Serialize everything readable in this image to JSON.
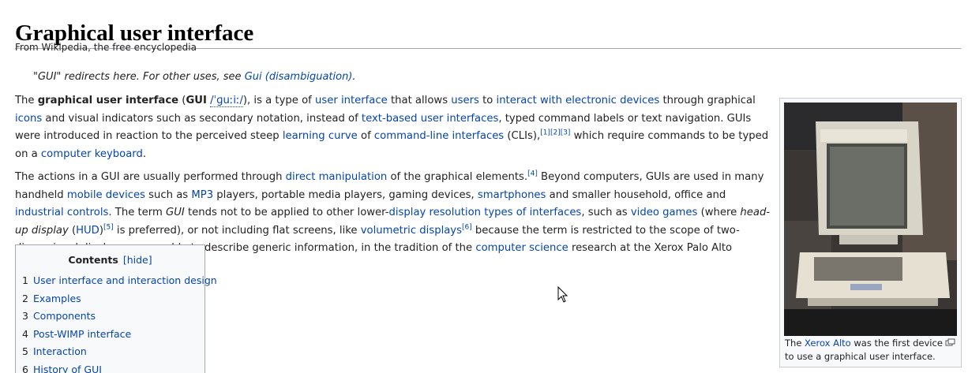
{
  "page": {
    "title": "Graphical user interface",
    "tagline": "From Wikipedia, the free encyclopedia"
  },
  "hatnote": {
    "prefix": "\"GUI\" redirects here. For other uses, see ",
    "link": "Gui (disambiguation)",
    "suffix": "."
  },
  "p1": {
    "t1": "The ",
    "b1": "graphical user interface",
    "t2": " (",
    "b2": "GUI",
    "t3": " ",
    "ipa": "/ˈɡuːiː/",
    "t4": "), is a type of ",
    "l1": "user interface",
    "t5": " that allows ",
    "l2": "users",
    "t6": " to ",
    "l3": "interact with electronic devices",
    "t7": " through graphical ",
    "l4": "icons",
    "t8": " and visual indicators such as secondary notation, instead of ",
    "l5": "text-based user interfaces",
    "t9": ", typed command labels or text navigation. GUIs were introduced in reaction to the perceived steep ",
    "l6": "learning curve",
    "t10": " of ",
    "l7": "command-line interfaces",
    "t11": " (CLIs),",
    "s1": "[1]",
    "s2": "[2]",
    "s3": "[3]",
    "t12": " which require commands to be typed on a ",
    "l8": "computer keyboard",
    "t13": "."
  },
  "p2": {
    "t1": "The actions in a GUI are usually performed through ",
    "l1": "direct manipulation",
    "t2": " of the graphical elements.",
    "s1": "[4]",
    "t3": " Beyond computers, GUIs are used in many handheld ",
    "l2": "mobile devices",
    "t4": " such as ",
    "l3": "MP3",
    "t5": " players, portable media players, gaming devices, ",
    "l4": "smartphones",
    "t6": " and smaller household, office and ",
    "l5": "industrial controls",
    "t7": ". The term ",
    "i1": "GUI",
    "t8": " tends not to be applied to other lower-",
    "l6": "display resolution types of interfaces",
    "t9": ", such as ",
    "l7": "video games",
    "t10": " (where ",
    "i2": "head-up display",
    "t11": " (",
    "l8": "HUD",
    "t12": ")",
    "s2": "[5]",
    "t13": " is preferred), or not including flat screens, like ",
    "l9": "volumetric displays",
    "s3": "[6]",
    "t14": " because the term is restricted to the scope of two-dimensional display screens able to describe generic information, in the tradition of the ",
    "l10": "computer science",
    "t15": " research at the Xerox Palo Alto Research Center."
  },
  "toc": {
    "title": "Contents",
    "hide_label": "[hide]",
    "items": [
      {
        "num": "1",
        "label": "User interface and interaction design"
      },
      {
        "num": "2",
        "label": "Examples"
      },
      {
        "num": "3",
        "label": "Components"
      },
      {
        "num": "4",
        "label": "Post-WIMP interface"
      },
      {
        "num": "5",
        "label": "Interaction"
      },
      {
        "num": "6",
        "label": "History of GUI"
      }
    ]
  },
  "thumb": {
    "caption_pre": "The ",
    "caption_link": "Xerox Alto",
    "caption_post": " was the first device to use a graphical user interface.",
    "icon": "magnify-icon"
  },
  "colors": {
    "link": "#0645ad",
    "text": "#222222",
    "border": "#a2a9b1"
  }
}
